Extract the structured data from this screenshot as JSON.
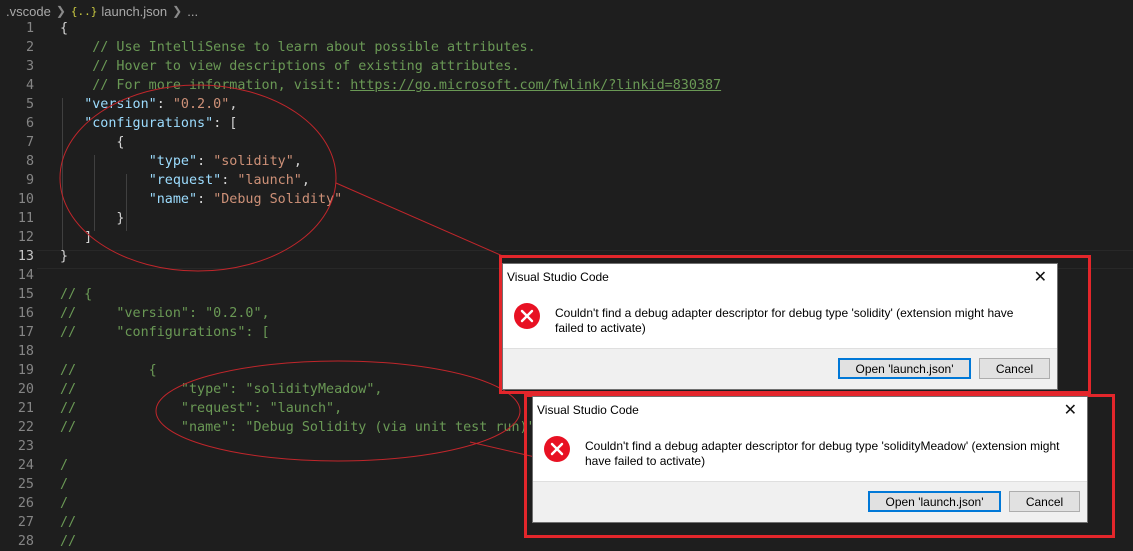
{
  "breadcrumb": {
    "folder": ".vscode",
    "file": "launch.json",
    "more": "..."
  },
  "editor": {
    "active_line": "13",
    "lines": [
      {
        "n": "1",
        "code": [
          [
            "p",
            "{"
          ]
        ]
      },
      {
        "n": "2",
        "code": [
          [
            "p",
            "    "
          ],
          [
            "c",
            "// Use IntelliSense to learn about possible attributes."
          ]
        ]
      },
      {
        "n": "3",
        "code": [
          [
            "p",
            "    "
          ],
          [
            "c",
            "// Hover to view descriptions of existing attributes."
          ]
        ]
      },
      {
        "n": "4",
        "code": [
          [
            "p",
            "    "
          ],
          [
            "c",
            "// For more information, visit: "
          ],
          [
            "cu",
            "https://go.microsoft.com/fwlink/?linkid=830387"
          ]
        ]
      },
      {
        "n": "5",
        "code": [
          [
            "p",
            "   "
          ],
          [
            "k",
            "\"version\""
          ],
          [
            "p",
            ": "
          ],
          [
            "s",
            "\"0.2.0\""
          ],
          [
            "p",
            ","
          ]
        ]
      },
      {
        "n": "6",
        "code": [
          [
            "p",
            "   "
          ],
          [
            "k",
            "\"configurations\""
          ],
          [
            "p",
            ": ["
          ]
        ]
      },
      {
        "n": "7",
        "code": [
          [
            "p",
            "       {"
          ]
        ]
      },
      {
        "n": "8",
        "code": [
          [
            "p",
            "           "
          ],
          [
            "k",
            "\"type\""
          ],
          [
            "p",
            ": "
          ],
          [
            "s",
            "\"solidity\""
          ],
          [
            "p",
            ","
          ]
        ]
      },
      {
        "n": "9",
        "code": [
          [
            "p",
            "           "
          ],
          [
            "k",
            "\"request\""
          ],
          [
            "p",
            ": "
          ],
          [
            "s",
            "\"launch\""
          ],
          [
            "p",
            ","
          ]
        ]
      },
      {
        "n": "10",
        "code": [
          [
            "p",
            "           "
          ],
          [
            "k",
            "\"name\""
          ],
          [
            "p",
            ": "
          ],
          [
            "s",
            "\"Debug Solidity\""
          ]
        ]
      },
      {
        "n": "11",
        "code": [
          [
            "p",
            "       }"
          ]
        ]
      },
      {
        "n": "12",
        "code": [
          [
            "p",
            "   ]"
          ]
        ]
      },
      {
        "n": "13",
        "code": [
          [
            "p",
            "}"
          ]
        ]
      },
      {
        "n": "14",
        "code": []
      },
      {
        "n": "15",
        "code": [
          [
            "c",
            "// {"
          ]
        ]
      },
      {
        "n": "16",
        "code": [
          [
            "c",
            "//     \"version\": \"0.2.0\","
          ]
        ]
      },
      {
        "n": "17",
        "code": [
          [
            "c",
            "//     \"configurations\": ["
          ]
        ]
      },
      {
        "n": "18",
        "code": []
      },
      {
        "n": "19",
        "code": [
          [
            "c",
            "//         {"
          ]
        ]
      },
      {
        "n": "20",
        "code": [
          [
            "c",
            "//             \"type\": \"solidityMeadow\","
          ]
        ]
      },
      {
        "n": "21",
        "code": [
          [
            "c",
            "//             \"request\": \"launch\","
          ]
        ]
      },
      {
        "n": "22",
        "code": [
          [
            "c",
            "//             \"name\": \"Debug Solidity (via unit test run)\""
          ]
        ]
      },
      {
        "n": "23",
        "code": []
      },
      {
        "n": "24",
        "code": [
          [
            "c",
            "/"
          ]
        ]
      },
      {
        "n": "25",
        "code": [
          [
            "c",
            "/"
          ]
        ]
      },
      {
        "n": "26",
        "code": [
          [
            "c",
            "/"
          ]
        ]
      },
      {
        "n": "27",
        "code": [
          [
            "c",
            "//"
          ]
        ]
      },
      {
        "n": "28",
        "code": [
          [
            "c",
            "//"
          ]
        ]
      }
    ]
  },
  "dialogs": [
    {
      "title": "Visual Studio Code",
      "message_line1": "Couldn't find a debug adapter descriptor for debug type 'solidity' (extension might have",
      "message_line2": "failed to activate)",
      "open_label": "Open 'launch.json'",
      "cancel_label": "Cancel"
    },
    {
      "title": "Visual Studio Code",
      "message_line1": "Couldn't find a debug adapter descriptor for debug type 'solidityMeadow' (extension might",
      "message_line2": "have failed to activate)",
      "open_label": "Open 'launch.json'",
      "cancel_label": "Cancel"
    }
  ],
  "colors": {
    "annotation_red": "#e3262b",
    "error_icon": "#e81123",
    "default_button_border": "#0078d7"
  },
  "icons": {
    "close": "close-icon",
    "error": "error-icon",
    "chevron": "chevron-right-icon",
    "json": "json-file-icon"
  }
}
